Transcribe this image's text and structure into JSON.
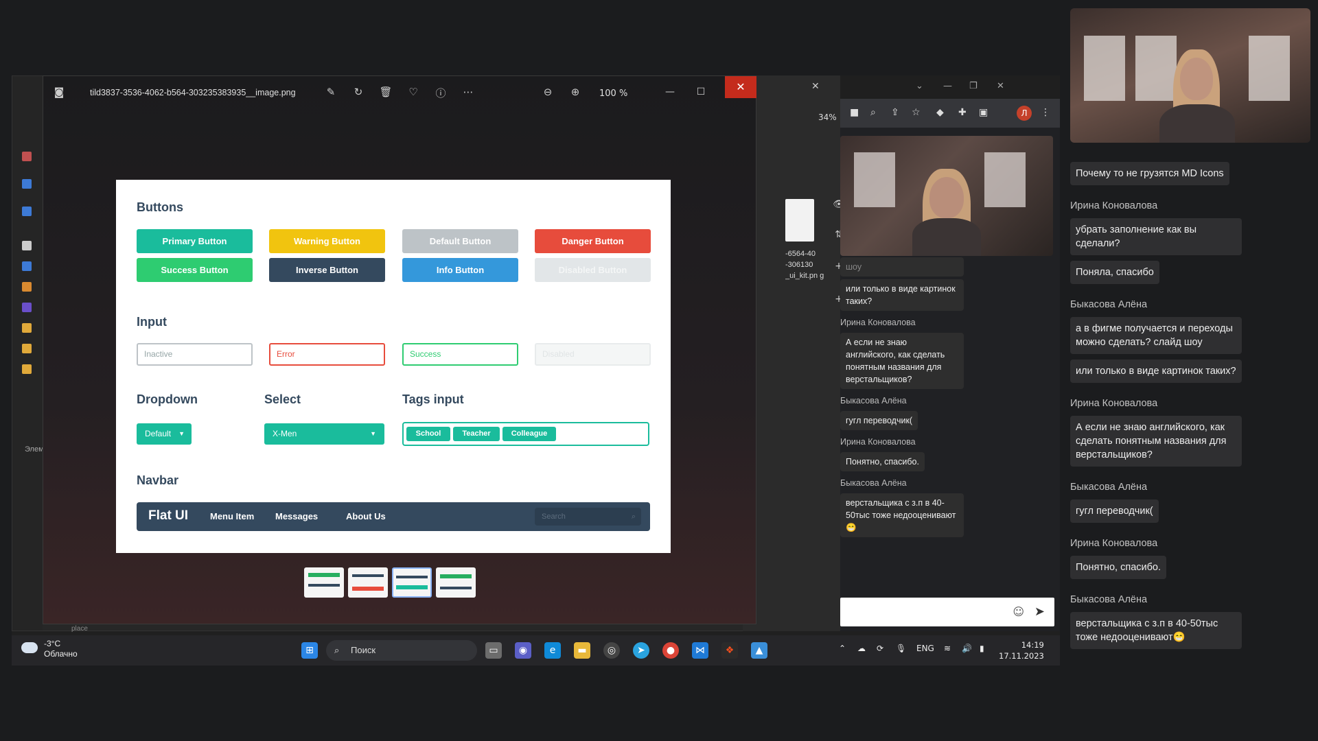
{
  "viewer": {
    "filename": "tild3837-3536-4062-b564-303235383935__image.png",
    "zoom": "100 %"
  },
  "kit": {
    "buttons_heading": "Buttons",
    "buttons": [
      "Primary Button",
      "Warning Button",
      "Default Button",
      "Danger Button",
      "Success Button",
      "Inverse Button",
      "Info Button",
      "Disabled Button"
    ],
    "button_colors": [
      "#1abc9c",
      "#f1c40f",
      "#bdc3c7",
      "#e74c3c",
      "#2ecc71",
      "#34495e",
      "#3498db",
      "#e2e6e8"
    ],
    "input_heading": "Input",
    "inputs": [
      "Inactive",
      "Error",
      "Success",
      "Disabled"
    ],
    "dropdown_heading": "Dropdown",
    "dropdown_value": "Default",
    "select_heading": "Select",
    "select_value": "X-Men",
    "tags_heading": "Tags input",
    "tags": [
      "School",
      "Teacher",
      "Colleague"
    ],
    "navbar_heading": "Navbar",
    "navbar": {
      "brand": "Flat UI",
      "items": [
        "Menu Item",
        "Messages",
        "About Us"
      ],
      "search_placeholder": "Search"
    }
  },
  "details": {
    "file_caption": "-6564-40 -306130 _ui_kit.pn g",
    "zoom": "34%"
  },
  "explorer": {
    "bottom_label": "Элем",
    "place_label": "place"
  },
  "browser_chat": [
    {
      "sender": "",
      "text": "шоу"
    },
    {
      "sender": "",
      "text": "или только в виде картинок таких?"
    },
    {
      "sender": "Ирина Коновалова",
      "text": "А если не знаю английского, как сделать понятным названия для верстальщиков?"
    },
    {
      "sender": "Быкасова Алёна",
      "text": "гугл переводчик("
    },
    {
      "sender": "Ирина Коновалова",
      "text": "Понятно, спасибо."
    },
    {
      "sender": "Быкасова Алёна",
      "text": "верстальщика с з.п в 40-50тыс тоже недооценивают😁"
    }
  ],
  "taskbar": {
    "temperature": "-3°C",
    "weather": "Облачно",
    "search": "Поиск",
    "lang": "ENG",
    "time": "14:19",
    "date": "17.11.2023"
  },
  "panel_chat": [
    {
      "sender": "",
      "messages": [
        "Почему то не грузятся MD Icons"
      ]
    },
    {
      "sender": "Ирина Коновалова",
      "messages": [
        "убрать заполнение как вы сделали?",
        "Поняла, спасибо"
      ]
    },
    {
      "sender": "Быкасова Алёна",
      "messages": [
        "а в фигме получается и переходы можно сделать? слайд шоу",
        "или только в виде картинок таких?"
      ]
    },
    {
      "sender": "Ирина Коновалова",
      "messages": [
        "А если не знаю английского, как сделать понятным названия для верстальщиков?"
      ]
    },
    {
      "sender": "Быкасова Алёна",
      "messages": [
        "гугл переводчик("
      ]
    },
    {
      "sender": "Ирина Коновалова",
      "messages": [
        "Понятно, спасибо."
      ]
    },
    {
      "sender": "Быкасова Алёна",
      "messages": [
        "верстальщика с з.п в 40-50тыс тоже недооценивают😁"
      ]
    }
  ],
  "browser_avatar": "Л"
}
